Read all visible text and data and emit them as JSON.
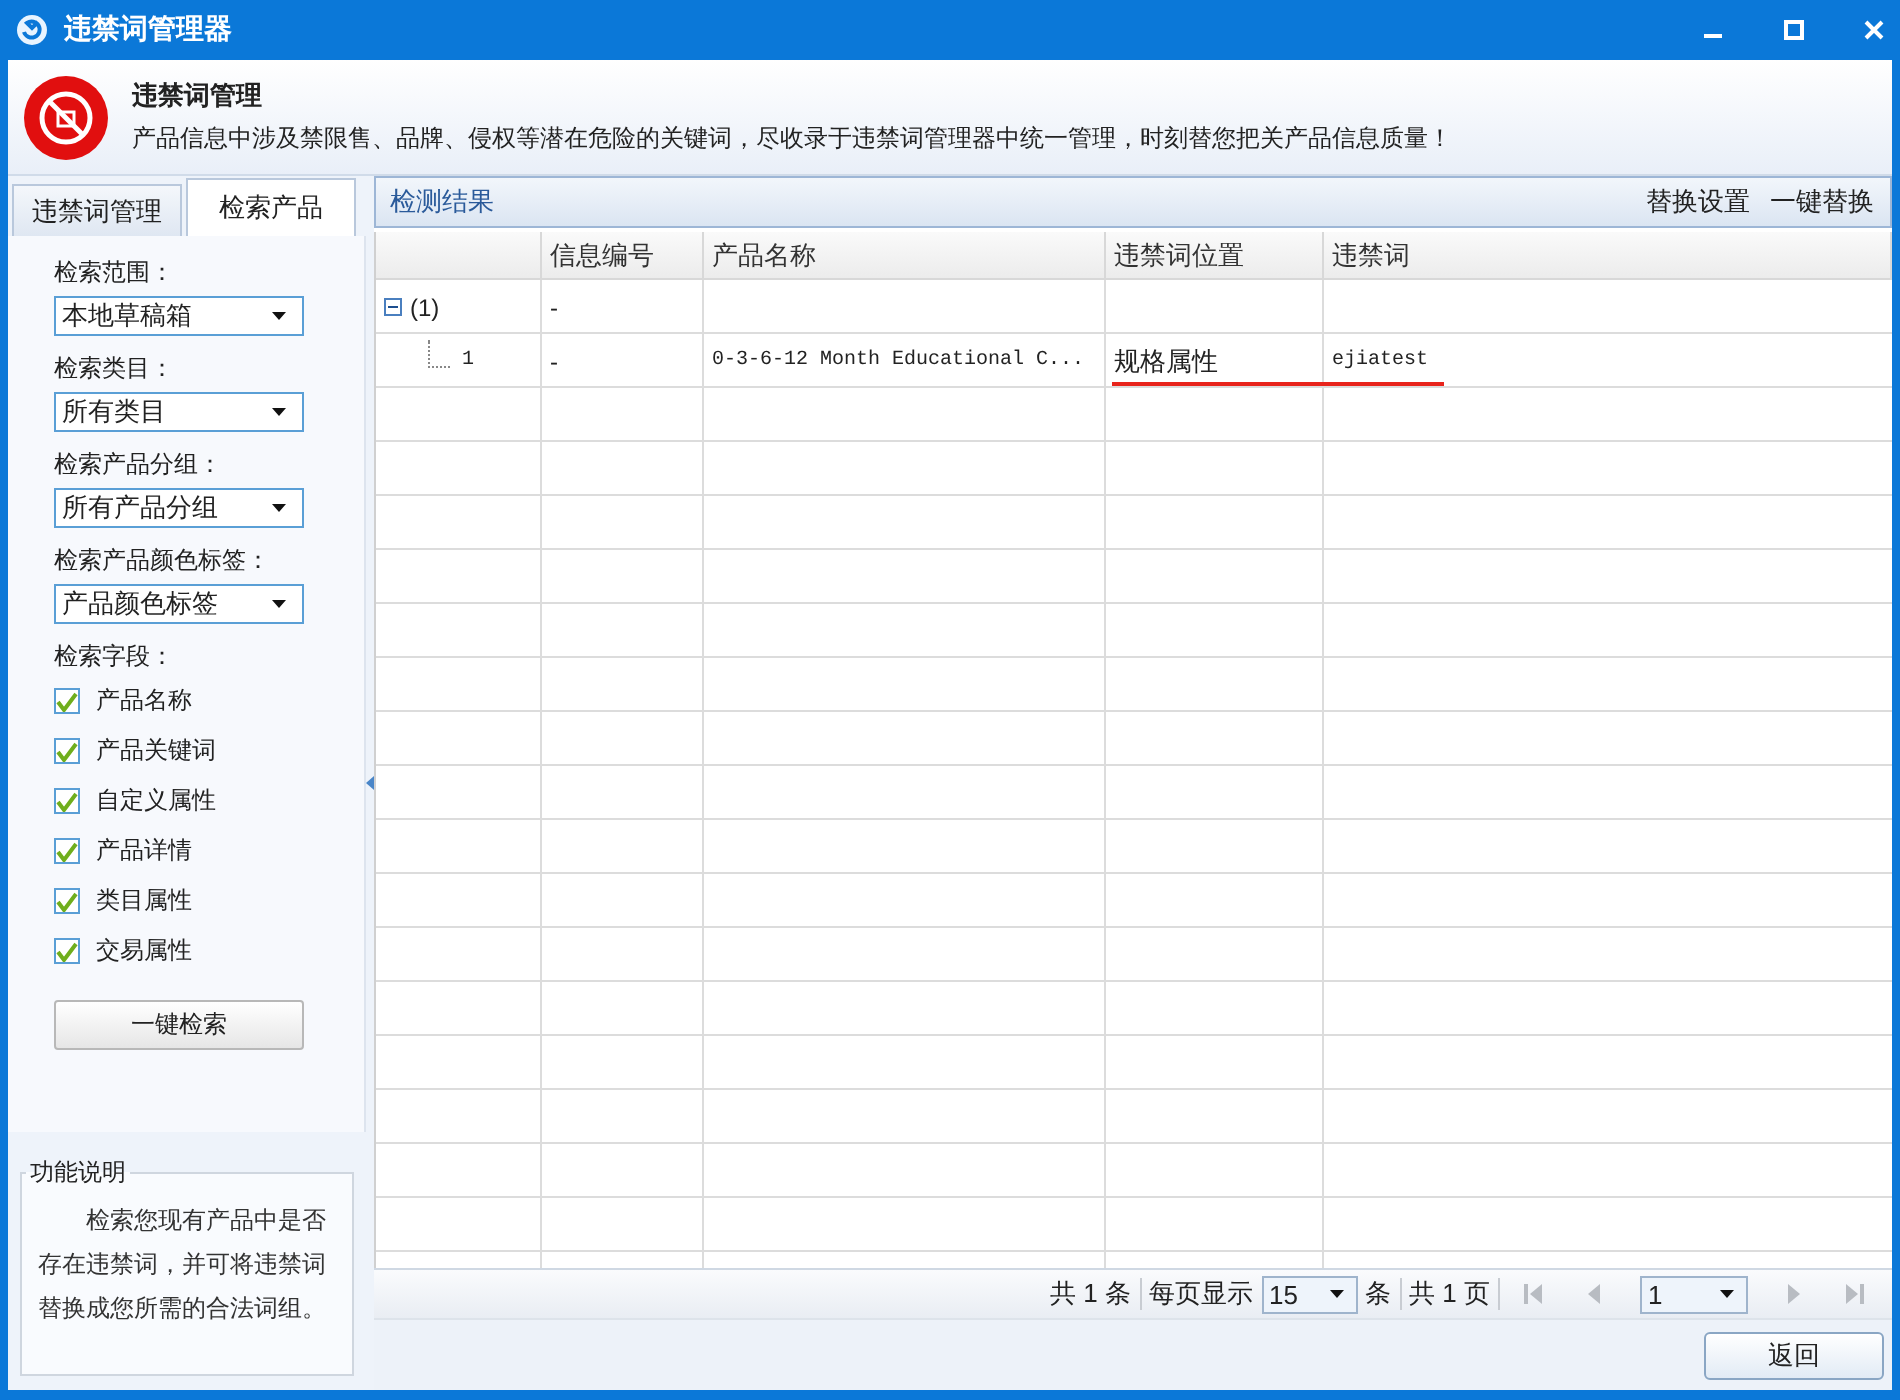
{
  "window": {
    "title": "违禁词管理器"
  },
  "header": {
    "title": "违禁词管理",
    "description": "产品信息中涉及禁限售、品牌、侵权等潜在危险的关键词，尽收录于违禁词管理器中统一管理，时刻替您把关产品信息质量！"
  },
  "tabs": [
    {
      "label": "违禁词管理",
      "selected": false
    },
    {
      "label": "检索产品",
      "selected": true
    }
  ],
  "search_form": {
    "selects": [
      {
        "label": "检索范围：",
        "value": "本地草稿箱"
      },
      {
        "label": "检索类目：",
        "value": "所有类目"
      },
      {
        "label": "检索产品分组：",
        "value": "所有产品分组"
      },
      {
        "label": "检索产品颜色标签：",
        "value": "产品颜色标签"
      }
    ],
    "fields_label": "检索字段：",
    "fields": [
      {
        "label": "产品名称",
        "checked": true
      },
      {
        "label": "产品关键词",
        "checked": true
      },
      {
        "label": "自定义属性",
        "checked": true
      },
      {
        "label": "产品详情",
        "checked": true
      },
      {
        "label": "类目属性",
        "checked": true
      },
      {
        "label": "交易属性",
        "checked": true
      }
    ],
    "search_button": "一键检索"
  },
  "help": {
    "title": "功能说明",
    "text": "检索您现有产品中是否存在违禁词，并可将违禁词替换成您所需的合法词组。"
  },
  "results": {
    "title": "检测结果",
    "actions": [
      "替换设置",
      "一键替换"
    ],
    "columns": [
      "信息编号",
      "产品名称",
      "违禁词位置",
      "违禁词"
    ],
    "groups": [
      {
        "label": "(1)",
        "info_no": "-",
        "expanded": true,
        "children": [
          {
            "index": "1",
            "info_no": "-",
            "product_name": "0-3-6-12 Month Educational C...",
            "position": "规格属性",
            "word": "ejiatest",
            "flagged": true
          }
        ]
      }
    ]
  },
  "pagination": {
    "total": "共 1 条",
    "per_page_label": "每页显示",
    "per_page": "15",
    "per_page_unit": "条",
    "pages": "共 1 页",
    "page": "1"
  },
  "back_button": "返回"
}
